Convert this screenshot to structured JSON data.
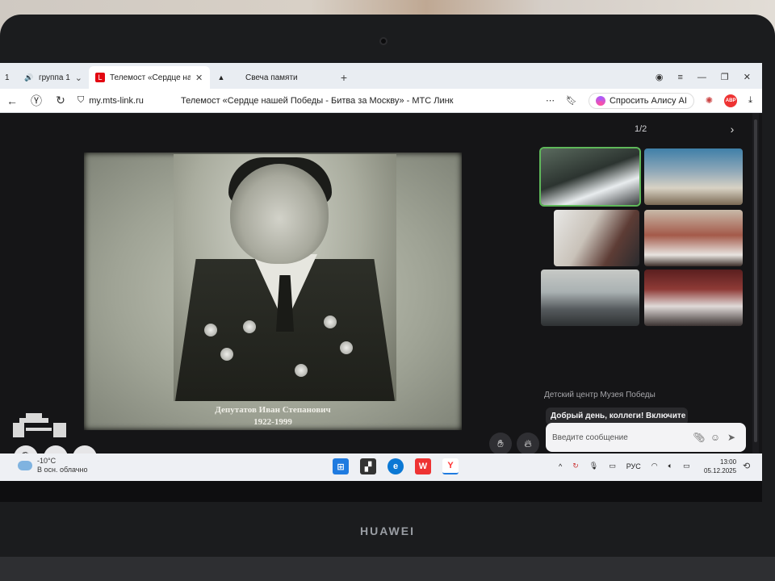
{
  "browser": {
    "tab_count": "1",
    "tabs": [
      {
        "label": "группа 1",
        "icon": "speaker-icon"
      },
      {
        "label": "Телемост «Сердце нашей Победы - Битва за Москву» - МТС Линк",
        "icon": "mts-link-icon",
        "active": true
      },
      {
        "label": "Свеча памяти",
        "icon": "warning-triangle-icon"
      }
    ],
    "url": "my.mts-link.ru",
    "page_title": "Телемост «Сердце нашей Победы - Битва за Москву» - МТС Линк",
    "alisa_button": "Спросить Алису AI",
    "adblock": "ABP"
  },
  "meeting": {
    "pager": "1/2",
    "slide": {
      "caption_name": "Депутатов Иван Степанович",
      "caption_years": "1922-1999"
    },
    "chat": {
      "sender": "Детский центр Музея Победы",
      "last_message": "Добрый день, коллеги! Включите",
      "input_placeholder": "Введите сообщение"
    }
  },
  "taskbar": {
    "weather_temp": "-10°C",
    "weather_desc": "В осн. облачно",
    "language": "РУС",
    "time": "13:00",
    "date": "05.12.2025"
  },
  "device": {
    "brand": "HUAWEI"
  },
  "colors": {
    "active_speaker": "#5fb85a",
    "mts_red": "#e30611",
    "chat_bg": "#2a2a2d"
  }
}
